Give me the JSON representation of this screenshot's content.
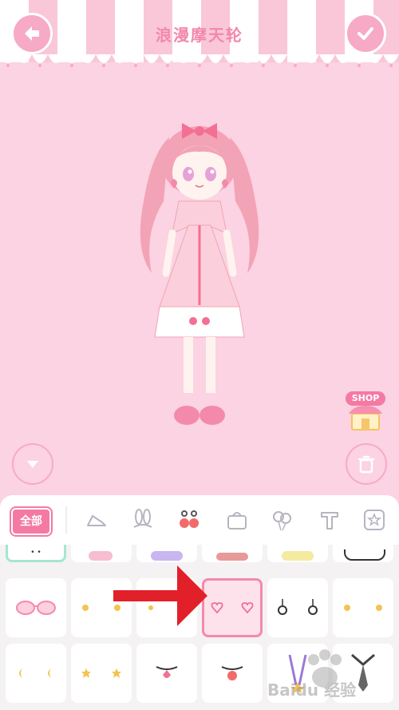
{
  "header": {
    "title": "浪漫摩天轮"
  },
  "toolbar": {
    "back_icon": "arrow-left-icon",
    "confirm_icon": "checkmark-icon",
    "collapse_icon": "chevron-down-icon",
    "delete_icon": "trash-icon"
  },
  "shop": {
    "label": "SHOP"
  },
  "tabs": {
    "all_label": "全部",
    "items": [
      "shoe-icon",
      "bunny-ears-icon",
      "earring-icon",
      "bag-icon",
      "balloon-icon",
      "text-icon",
      "star-icon"
    ],
    "active_index": 2
  },
  "watermark": {
    "text": "Baidu 经验"
  },
  "colors": {
    "background": "#fbd3e2",
    "accent": "#f47aa3",
    "title": "#f387ad",
    "selected_border": "#f489ab",
    "arrow": "#e2202a"
  }
}
